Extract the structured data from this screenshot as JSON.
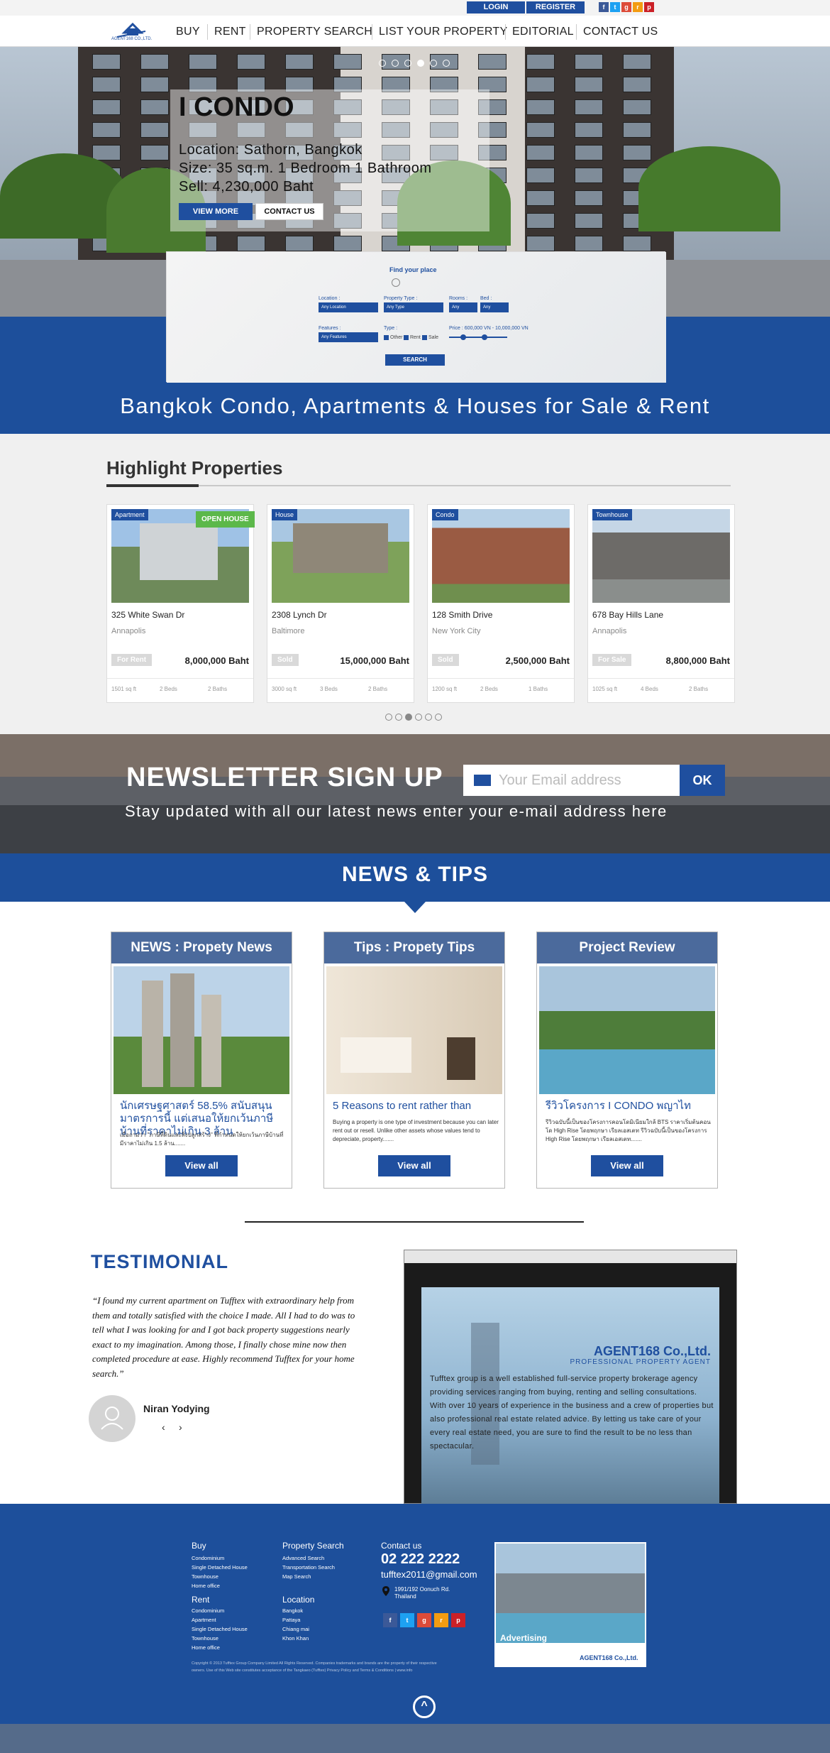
{
  "topbar": {
    "login": "LOGIN",
    "register": "REGISTER",
    "social": [
      "f",
      "t",
      "g+",
      "rss",
      "p"
    ]
  },
  "nav": {
    "items": [
      "BUY",
      "RENT",
      "PROPERTY SEARCH",
      "LIST YOUR PROPERTY",
      "EDITORIAL",
      "CONTACT US"
    ],
    "logo_text": "AGENT168 CO.,LTD."
  },
  "hero": {
    "title": "I CONDO",
    "location": "Location: Sathorn, Bangkok",
    "size": "Size: 35 sq.m. 1 Bedroom 1 Bathroom",
    "sell": "Sell: 4,230,000 Baht",
    "view_more": "VIEW MORE",
    "contact_us": "CONTACT US"
  },
  "search": {
    "title": "Find your place",
    "location_label": "Location :",
    "location_value": "Any Location",
    "type_label": "Property Type :",
    "type_value": "Any Type",
    "rooms_label": "Rooms :",
    "rooms_value": "Any",
    "bed_label": "Bed :",
    "bed_value": "Any",
    "features_label": "Features :",
    "features_value": "Any Features",
    "type_label2": "Type :",
    "types": [
      "Other",
      "Rent",
      "Sale"
    ],
    "price_label": "Price : 600,000 VN - 10,000,000 VN",
    "button": "SEARCH"
  },
  "tagline": "Bangkok Condo, Apartments & Houses for Sale & Rent",
  "highlight": {
    "title": "Highlight Properties",
    "open_house": "OPEN HOUSE",
    "cards": [
      {
        "tag": "Apartment",
        "address": "325 White Swan Dr",
        "city": "Annapolis",
        "status": "For Rent",
        "price": "8,000,000 Baht",
        "sqft": "1501 sq ft",
        "beds": "2 Beds",
        "baths": "2 Baths"
      },
      {
        "tag": "House",
        "address": "2308 Lynch Dr",
        "city": "Baltimore",
        "status": "Sold",
        "price": "15,000,000 Baht",
        "sqft": "3000 sq ft",
        "beds": "3 Beds",
        "baths": "2 Baths"
      },
      {
        "tag": "Condo",
        "address": "128 Smith Drive",
        "city": "New York City",
        "status": "Sold",
        "price": "2,500,000 Baht",
        "sqft": "1200 sq ft",
        "beds": "2 Beds",
        "baths": "1 Baths"
      },
      {
        "tag": "Townhouse",
        "address": "678 Bay Hills Lane",
        "city": "Annapolis",
        "status": "For Sale",
        "price": "8,800,000 Baht",
        "sqft": "1025 sq ft",
        "beds": "4 Beds",
        "baths": "2 Baths"
      }
    ]
  },
  "newsletter": {
    "title": "NEWSLETTER SIGN UP",
    "subtitle": "Stay updated with all our latest news enter your e-mail address here",
    "placeholder": "Your Email address",
    "ok": "OK"
  },
  "news": {
    "title": "NEWS & TIPS",
    "cards": [
      {
        "head": "NEWS : Propety News",
        "title": "นักเศรษฐศาสตร์ 58.5% สนับสนุนมาตรการนี้ แต่เสนอให้ยกเว้นภาษีบ้านที่ราคาไม่เกิน 3 ล้าน",
        "text": "เมื่อถามว่า \"ภาษีที่ดินและสิ่งปลูกสร้าง\" ที่กำหนดให้ยกเว้นภาษีบ้านที่มีราคาไม่เกิน 1.5 ล้าน.......",
        "button": "View all"
      },
      {
        "head": "Tips : Propety Tips",
        "title": "5 Reasons to rent rather than",
        "text": "Buying a property is one type of investment because you can later rent out or resell. Unlike other assets whose values tend to depreciate, property.......",
        "button": "View all"
      },
      {
        "head": "Project Review",
        "title": "รีวิวโครงการ I CONDO พญาไท",
        "text": "รีวิวฉบับนี้เป็นของโครงการคอนโดมิเนียมใกล้ BTS ราคาเริ่มต้นคอนโด High Rise โดยพฤกษา เรียลเอสเตท รีวิวฉบับนี้เป็นของโครงการ High Rise โดยพฤกษา เรียลเอสเตท.......",
        "button": "View all"
      }
    ]
  },
  "testimonial": {
    "title": "TESTIMONIAL",
    "quote": "“I found my current apartment on Tufftex with extraordinary help from them and totally satisfied with the choice I made. All I had to do was to tell what I was looking for and I got back property suggestions nearly exact to my imagination. Among those, I finally chose mine now then completed procedure at ease. Highly recommend Tufftex for your home search.”",
    "name": "Niran Yodying",
    "prev": "‹",
    "next": "›"
  },
  "about": {
    "company": "AGENT168 Co.,Ltd.",
    "subtitle": "PROFESSIONAL PROPERTY AGENT",
    "text": "Tufftex group is a well established full-service property brokerage agency providing services ranging from buying, renting and selling consultations. With over 10 years of experience in the business and a crew of properties but also professional real estate related advice. By letting us take care of your every real estate need, you are sure to find the result to be no less than spectacular."
  },
  "footer": {
    "buy": {
      "head": "Buy",
      "items": [
        "Condominium",
        "Single Detached House",
        "Townhouse",
        "Home office"
      ]
    },
    "rent": {
      "head": "Rent",
      "items": [
        "Condominium",
        "Apartment",
        "Single Detached House",
        "Townhouse",
        "Home office"
      ]
    },
    "search": {
      "head": "Property Search",
      "items": [
        "Advanced Search",
        "Transportation Search",
        "Map Search"
      ]
    },
    "location": {
      "head": "Location",
      "items": [
        "Bangkok",
        "Pattaya",
        "Chiang mai",
        "Khon Khan"
      ]
    },
    "contact": {
      "head": "Contact us",
      "phone": "02 222 2222",
      "email": "tufftex2011@gmail.com",
      "address": "1991/192 Oonuch Rd. Thailand"
    },
    "copyright": "Copyright © 2013 Tufftex Group Company Limited All Rights Reserved. Companies trademarks and brands are the property of their respective owners. Use of this Web site constitutes acceptance of the Tangkaeo (Tufftex) Privacy Policy and Terms & Conditions | www.info",
    "ad_label": "Advertising",
    "ad_brand": "AGENT168 Co.,Ltd.",
    "up": "^"
  }
}
